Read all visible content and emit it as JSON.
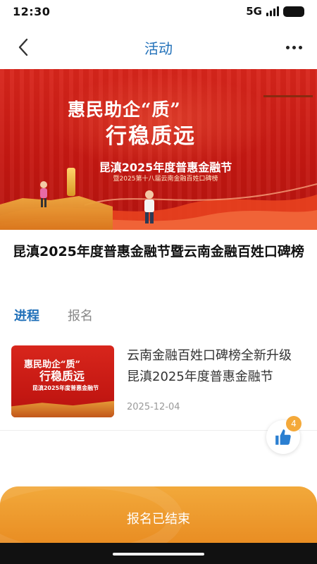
{
  "status_bar": {
    "time": "12:30",
    "network": "5G"
  },
  "nav": {
    "title": "活动",
    "back_icon": "chevron-left-icon",
    "more_icon": "more-horizontal-icon"
  },
  "banner": {
    "slogan_line1": "惠民助企“质”",
    "slogan_line2": "行稳质远",
    "subtitle": "昆滇2025年度普惠金融节",
    "subline": "暨2025第十八届云南金融百姓口碑榜"
  },
  "article": {
    "title": "昆滇2025年度普惠金融节暨云南金融百姓口碑榜"
  },
  "tabs": [
    {
      "label": "进程",
      "active": true
    },
    {
      "label": "报名",
      "active": false
    }
  ],
  "list": [
    {
      "title": "云南金融百姓口碑榜全新升级 昆滇2025年度普惠金融节",
      "date": "2025-12-04",
      "thumb": {
        "line1": "惠民助企“质”",
        "line2": "行稳质远",
        "line3": "昆滇2025年度普惠金融节"
      }
    }
  ],
  "like": {
    "icon": "thumbs-up-icon",
    "count": "4"
  },
  "bottom_button": {
    "label": "报名已结束"
  },
  "colors": {
    "accent": "#1f6fb8",
    "banner_red": "#d8261c",
    "button_orange": "#f2a93b"
  }
}
